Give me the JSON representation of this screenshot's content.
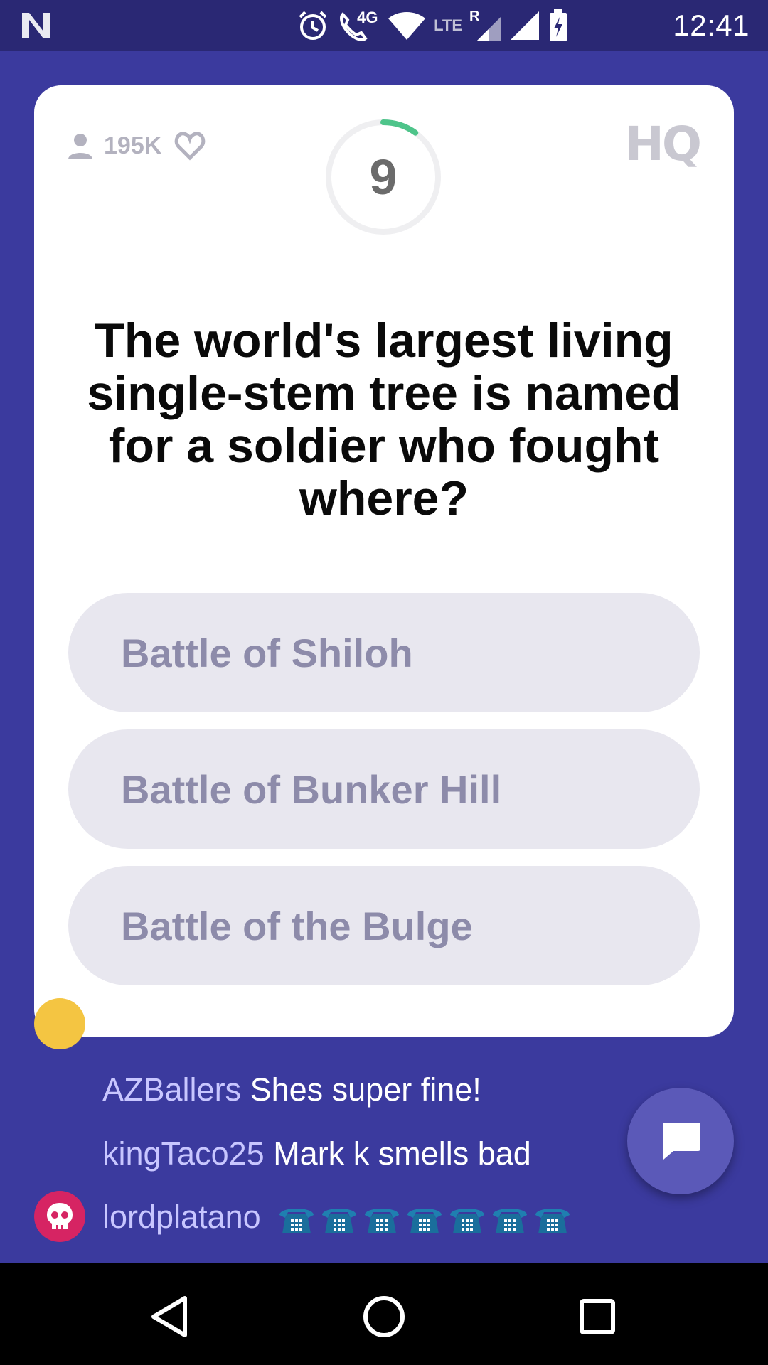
{
  "status_bar": {
    "time": "12:41",
    "network_label": "4G",
    "lte_label": "LTE",
    "roaming_label": "R"
  },
  "card": {
    "viewer_count": "195K",
    "timer_value": "9",
    "timer_progress": 0.1,
    "logo": "HQ",
    "question": "The world's largest living single-stem tree is named for a soldier who fought where?",
    "answers": [
      {
        "label": "Battle of Shiloh"
      },
      {
        "label": "Battle of Bunker Hill"
      },
      {
        "label": "Battle of the Bulge"
      }
    ]
  },
  "chat": {
    "messages": [
      {
        "user": "AZBallers",
        "text": "Shes super fine!"
      },
      {
        "user": "kingTaco25",
        "text": "Mark k smells bad"
      },
      {
        "user": "lordplatano",
        "text": "",
        "emoji_name": "telephone-emoji",
        "emoji_count": 7
      }
    ]
  },
  "colors": {
    "background": "#3b3a9e",
    "status_bar": "#2a2874",
    "timer_accent": "#4ec48a",
    "answer_bg": "#e8e7ef",
    "answer_text": "#8d8baa",
    "username": "#c8c6ff",
    "skull_avatar": "#d62463",
    "fab": "#5b59b8"
  },
  "icons": {
    "status_left": "n-logo-icon",
    "alarm": "alarm-icon",
    "call": "wifi-call-icon",
    "wifi": "wifi-icon",
    "signal": "signal-icon",
    "battery": "battery-charging-icon",
    "viewer": "person-icon",
    "like": "heart-icon",
    "chat_button": "chat-bubble-icon",
    "nav_back": "back-triangle-icon",
    "nav_home": "home-circle-icon",
    "nav_recent": "recent-apps-square-icon"
  }
}
